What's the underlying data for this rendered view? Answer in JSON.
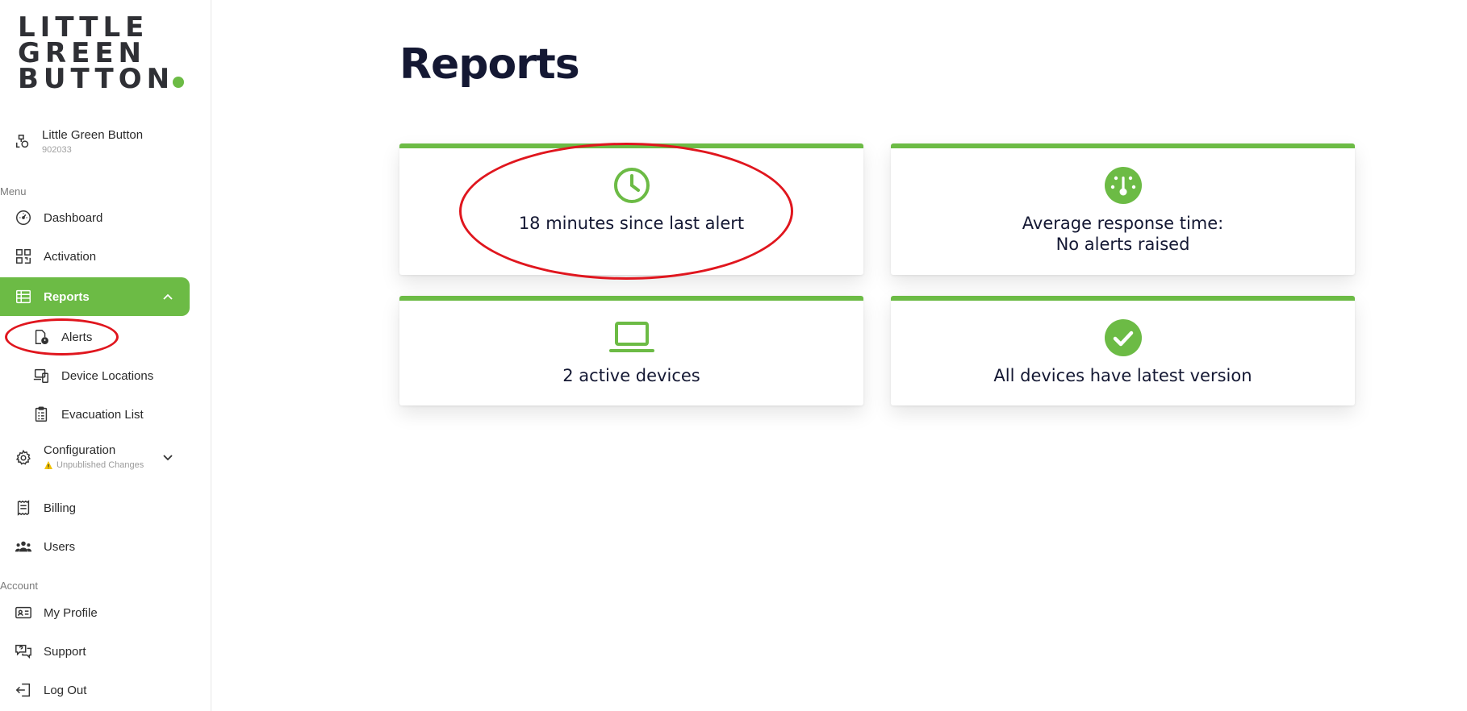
{
  "brand": {
    "logo_lines": [
      "LITTLE",
      "GREEN",
      "BUTTON"
    ],
    "accent": "#6cbb45"
  },
  "org": {
    "name": "Little Green Button",
    "id": "902033",
    "icon": "org-switch-icon"
  },
  "sections": {
    "menu": "Menu",
    "account": "Account"
  },
  "nav": {
    "dashboard": "Dashboard",
    "activation": "Activation",
    "reports": "Reports",
    "alerts": "Alerts",
    "device_locations": "Device Locations",
    "evacuation_list": "Evacuation List",
    "configuration": "Configuration",
    "configuration_status": "Unpublished Changes",
    "billing": "Billing",
    "users": "Users",
    "my_profile": "My Profile",
    "support": "Support",
    "log_out": "Log Out"
  },
  "page": {
    "title": "Reports"
  },
  "cards": {
    "last_alert": "18 minutes since last alert",
    "avg_response_line1": "Average response time:",
    "avg_response_line2": "No alerts raised",
    "active_devices": "2 active devices",
    "latest_version": "All devices have latest version"
  },
  "colors": {
    "annotation": "#e0161e",
    "warning": "#f2c200",
    "title": "#141833"
  }
}
